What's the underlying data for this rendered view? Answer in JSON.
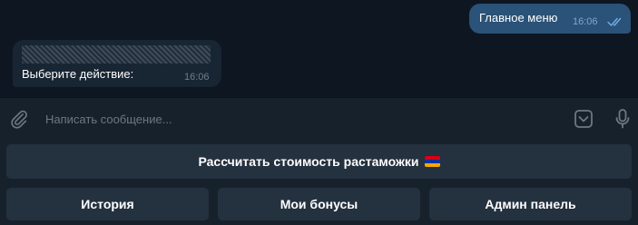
{
  "chat": {
    "outgoing": {
      "text": "Главное меню",
      "time": "16:06"
    },
    "incoming": {
      "text": "Выберите действие:",
      "time": "16:06"
    }
  },
  "composer": {
    "placeholder": "Написать сообщение..."
  },
  "keyboard": {
    "calc_label": "Рассчитать стоимость растаможки",
    "calc_emoji": "armenia-flag",
    "history_label": "История",
    "bonuses_label": "Мои бонусы",
    "admin_label": "Админ панель"
  },
  "colors": {
    "background": "#0e1621",
    "outgoing_bubble": "#2b5278",
    "incoming_bubble": "#182533",
    "panel": "#17212b",
    "button": "#24313f",
    "flag": [
      "#d90012",
      "#0033a0",
      "#f2a800"
    ]
  },
  "icons": [
    "attach-icon",
    "sticker-icon",
    "mic-icon",
    "double-check-icon"
  ]
}
